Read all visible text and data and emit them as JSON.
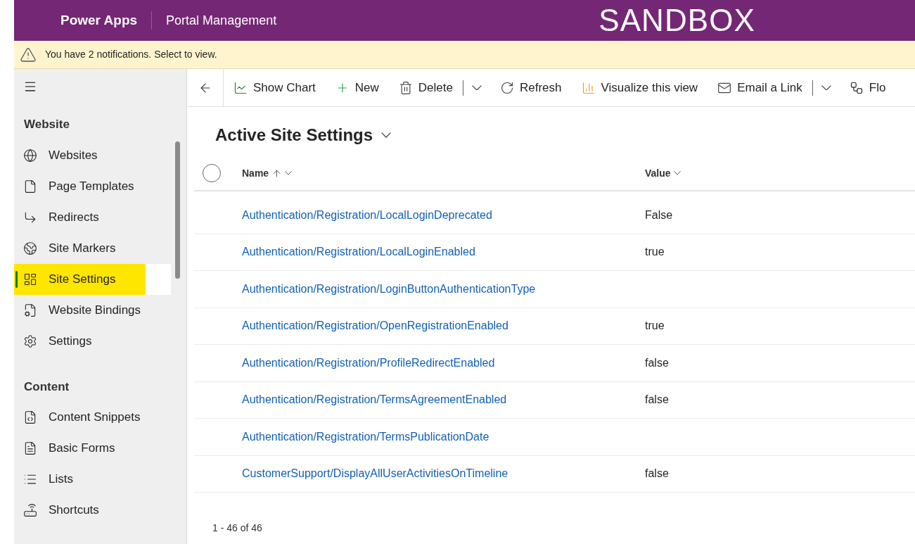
{
  "header": {
    "app_name": "Power Apps",
    "area_name": "Portal Management",
    "environment": "SANDBOX"
  },
  "notification": {
    "text": "You have 2 notifications. Select to view."
  },
  "sidebar": {
    "groups": [
      {
        "title": "Website",
        "items": [
          {
            "label": "Websites",
            "selected": false
          },
          {
            "label": "Page Templates",
            "selected": false
          },
          {
            "label": "Redirects",
            "selected": false
          },
          {
            "label": "Site Markers",
            "selected": false
          },
          {
            "label": "Site Settings",
            "selected": true
          },
          {
            "label": "Website Bindings",
            "selected": false
          },
          {
            "label": "Settings",
            "selected": false
          }
        ]
      },
      {
        "title": "Content",
        "items": [
          {
            "label": "Content Snippets",
            "selected": false
          },
          {
            "label": "Basic Forms",
            "selected": false
          },
          {
            "label": "Lists",
            "selected": false
          },
          {
            "label": "Shortcuts",
            "selected": false
          }
        ]
      }
    ]
  },
  "toolbar": [
    {
      "kind": "back"
    },
    {
      "kind": "button",
      "label": "Show Chart"
    },
    {
      "kind": "button",
      "label": "New"
    },
    {
      "kind": "button",
      "label": "Delete"
    },
    {
      "kind": "split"
    },
    {
      "kind": "button",
      "label": "Refresh"
    },
    {
      "kind": "button",
      "label": "Visualize this view"
    },
    {
      "kind": "button",
      "label": "Email a Link"
    },
    {
      "kind": "split"
    },
    {
      "kind": "button",
      "label": "Flo"
    }
  ],
  "view": {
    "title": "Active Site Settings"
  },
  "table": {
    "select_all": {
      "checked": false
    },
    "columns": [
      {
        "label": "Name",
        "sorted": true
      },
      {
        "label": "Value",
        "sorted": false
      }
    ],
    "rows": [
      {
        "name": "Authentication/Registration/LocalLoginDeprecated",
        "value": "False"
      },
      {
        "name": "Authentication/Registration/LocalLoginEnabled",
        "value": "true"
      },
      {
        "name": "Authentication/Registration/LoginButtonAuthenticationType"
      },
      {
        "name": "Authentication/Registration/OpenRegistrationEnabled",
        "value": "true"
      },
      {
        "name": "Authentication/Registration/ProfileRedirectEnabled",
        "value": "false"
      },
      {
        "name": "Authentication/Registration/TermsAgreementEnabled",
        "value": "false"
      },
      {
        "name": "Authentication/Registration/TermsPublicationDate"
      },
      {
        "name": "CustomerSupport/DisplayAllUserActivitiesOnTimeline",
        "value": "false"
      }
    ]
  },
  "footer": {
    "count": "1 - 46 of 46"
  }
}
